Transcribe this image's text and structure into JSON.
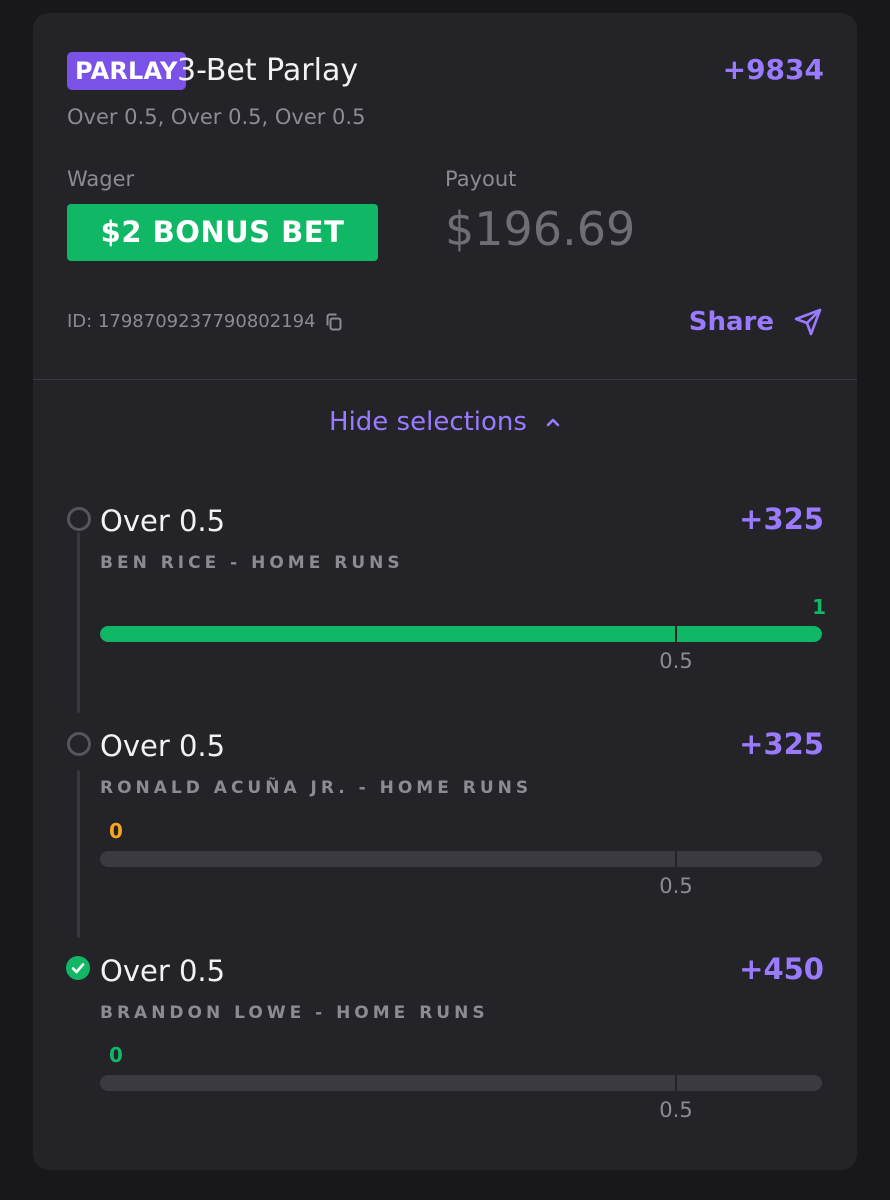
{
  "bet": {
    "badge": "PARLAY",
    "title": "3-Bet Parlay",
    "odds": "+9834",
    "subtitle": "Over 0.5, Over 0.5, Over 0.5",
    "wager_label": "Wager",
    "wager_value": "$2 BONUS BET",
    "payout_label": "Payout",
    "payout_value": "$196.69",
    "id_text": "ID: 1798709237790802194",
    "share_label": "Share",
    "toggle_label": "Hide selections"
  },
  "legs": [
    {
      "title": "Over 0.5",
      "market": "BEN RICE - HOME RUNS",
      "odds": "+325",
      "current": "1",
      "line": "0.5",
      "progress": 1.0,
      "status": "pending",
      "current_color": "#10b764"
    },
    {
      "title": "Over 0.5",
      "market": "RONALD ACUÑA JR. - HOME RUNS",
      "odds": "+325",
      "current": "0",
      "line": "0.5",
      "progress": 0.0,
      "status": "pending",
      "current_color": "#f5a623"
    },
    {
      "title": "Over 0.5",
      "market": "BRANDON LOWE - HOME RUNS",
      "odds": "+450",
      "current": "0",
      "line": "0.5",
      "progress": 0.0,
      "status": "won",
      "current_color": "#10b764"
    }
  ],
  "colors": {
    "accent": "#9a7bff",
    "success": "#10b764",
    "warning": "#f5a623",
    "card": "#242328",
    "background": "#18171b"
  },
  "icons": {
    "copy": "copy-icon",
    "share": "send-icon",
    "toggle": "chevron-up-icon",
    "pending": "circle-icon",
    "won": "check-circle-icon"
  }
}
